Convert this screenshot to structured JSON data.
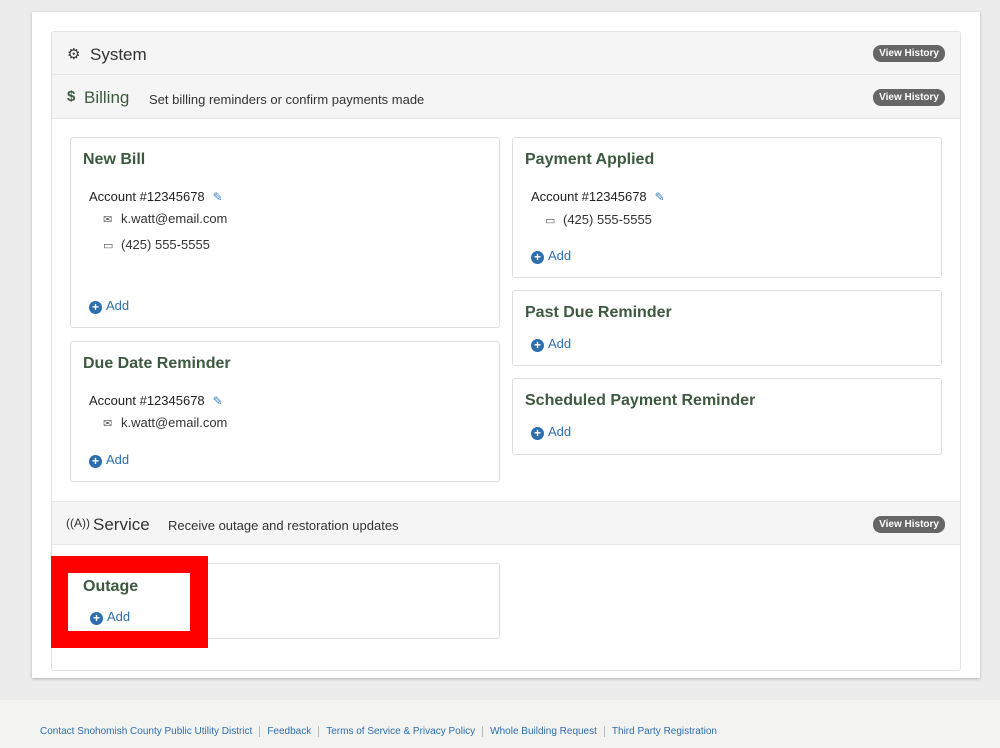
{
  "system": {
    "title": "System",
    "badge": "View History"
  },
  "billing": {
    "title": "Billing",
    "desc": "Set billing reminders or confirm payments made",
    "badge": "View History"
  },
  "new_bill": {
    "title": "New Bill",
    "account": "Account #12345678",
    "email": "k.watt@email.com",
    "phone": "(425) 555-5555",
    "add": "Add"
  },
  "due_date": {
    "title": "Due Date Reminder",
    "account": "Account #12345678",
    "email": "k.watt@email.com",
    "add": "Add"
  },
  "payment_applied": {
    "title": "Payment Applied",
    "account": "Account #12345678",
    "phone": "(425) 555-5555",
    "add": "Add"
  },
  "past_due": {
    "title": "Past Due Reminder",
    "add": "Add"
  },
  "scheduled": {
    "title": "Scheduled Payment Reminder",
    "add": "Add"
  },
  "service": {
    "title": "Service",
    "desc": "Receive outage and restoration updates",
    "badge": "View History"
  },
  "outage": {
    "title": "Outage",
    "add": "Add"
  },
  "footer": {
    "links": [
      "Contact Snohomish County Public Utility District",
      "Feedback",
      "Terms of Service & Privacy Policy",
      "Whole Building Request",
      "Third Party Registration"
    ]
  }
}
